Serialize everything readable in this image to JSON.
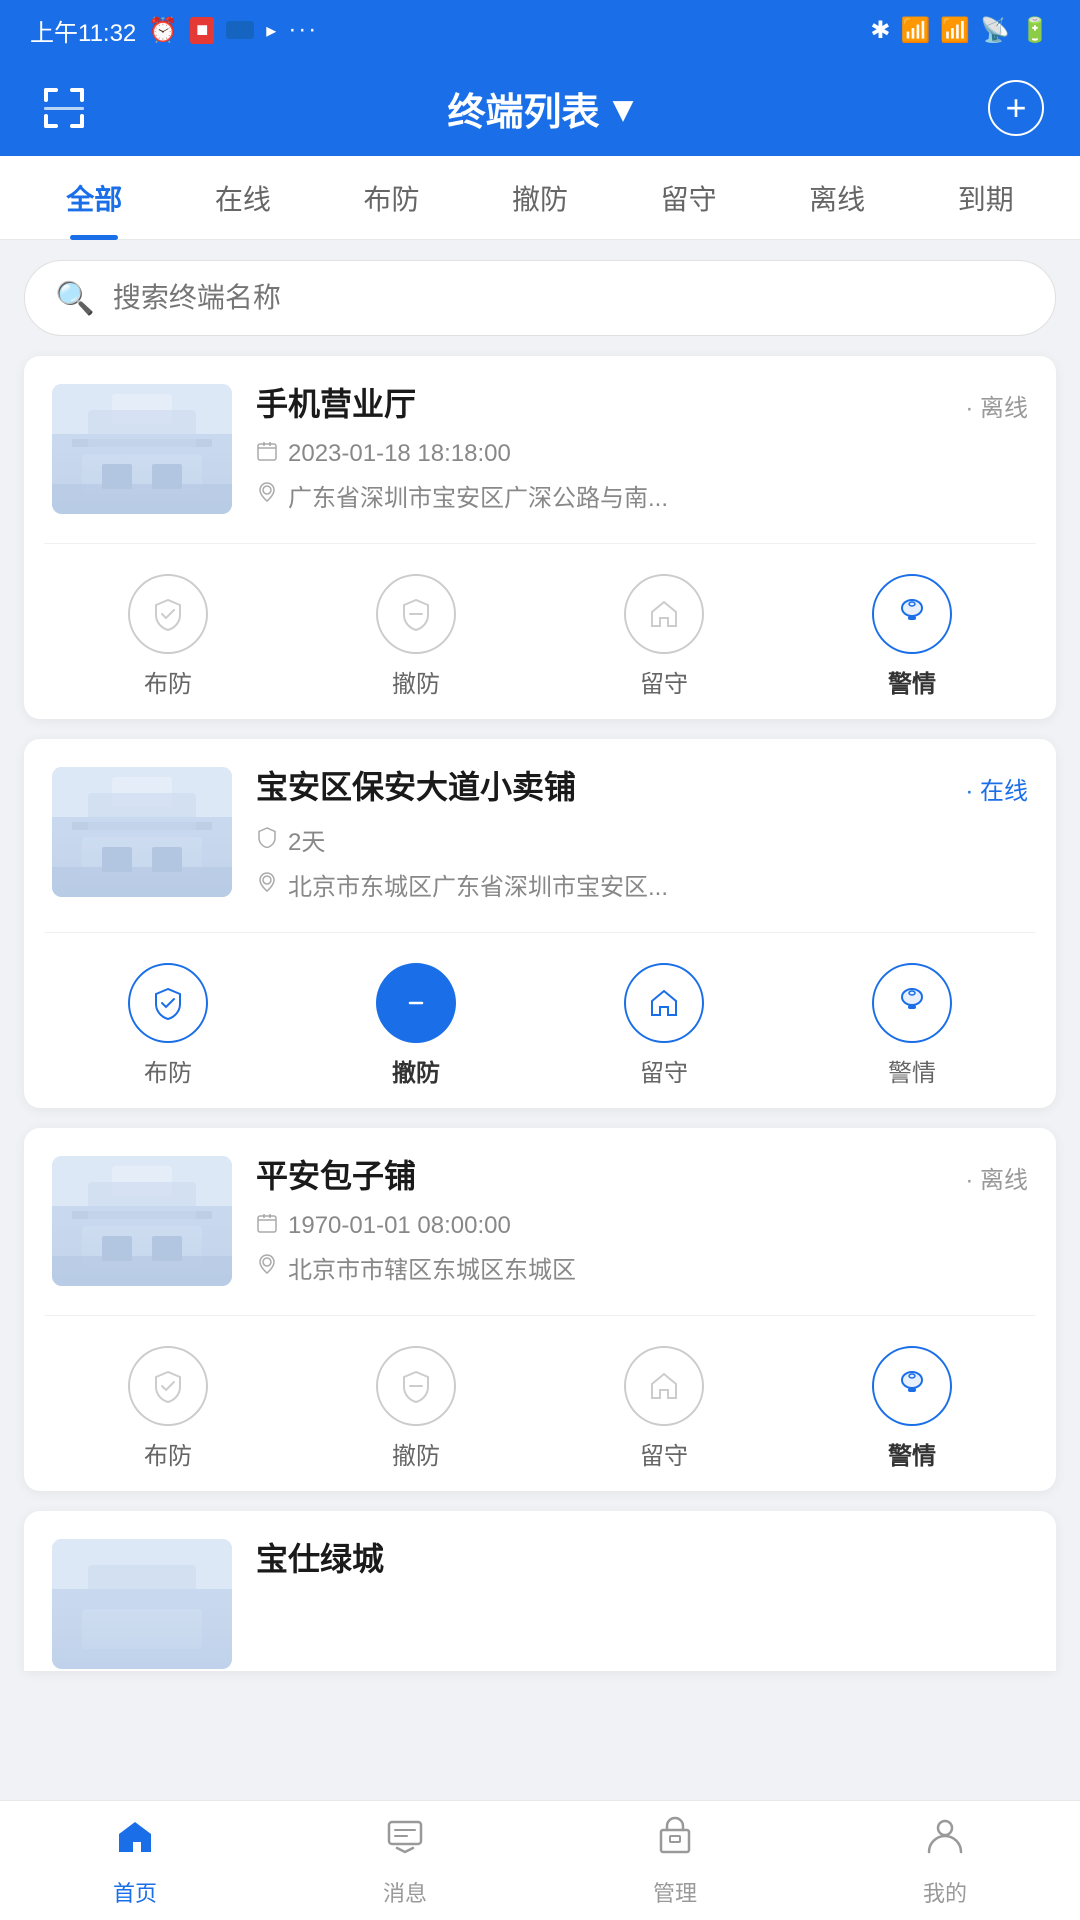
{
  "statusBar": {
    "time": "上午11:32",
    "icons": [
      "clock",
      "sim1",
      "sim2",
      "wifi",
      "battery"
    ]
  },
  "header": {
    "title": "终端列表",
    "dropdownArrow": "▾",
    "scanLabel": "scan",
    "addLabel": "add"
  },
  "tabs": [
    {
      "id": "all",
      "label": "全部",
      "active": true
    },
    {
      "id": "online",
      "label": "在线",
      "active": false
    },
    {
      "id": "armed",
      "label": "布防",
      "active": false
    },
    {
      "id": "disarmed",
      "label": "撤防",
      "active": false
    },
    {
      "id": "stay",
      "label": "留守",
      "active": false
    },
    {
      "id": "offline",
      "label": "离线",
      "active": false
    },
    {
      "id": "expired",
      "label": "到期",
      "active": false
    }
  ],
  "search": {
    "placeholder": "搜索终端名称"
  },
  "cards": [
    {
      "id": "card1",
      "name": "手机营业厅",
      "status": "· 离线",
      "statusType": "offline",
      "datetime": "2023-01-18 18:18:00",
      "address": "广东省深圳市宝安区广深公路与南...",
      "actions": [
        {
          "id": "arm",
          "label": "布防",
          "iconType": "shield-check",
          "state": "normal"
        },
        {
          "id": "disarm",
          "label": "撤防",
          "iconType": "shield-minus",
          "state": "normal"
        },
        {
          "id": "stay",
          "label": "留守",
          "iconType": "home",
          "state": "normal"
        },
        {
          "id": "alarm",
          "label": "警情",
          "iconType": "bell",
          "state": "active-blue"
        }
      ]
    },
    {
      "id": "card2",
      "name": "宝安区保安大道小卖铺",
      "status": "· 在线",
      "statusType": "online",
      "datetime": "2天",
      "address": "北京市东城区广东省深圳市宝安区...",
      "actions": [
        {
          "id": "arm",
          "label": "布防",
          "iconType": "shield-check",
          "state": "active-blue"
        },
        {
          "id": "disarm",
          "label": "撤防",
          "iconType": "shield-minus",
          "state": "filled-blue"
        },
        {
          "id": "stay",
          "label": "留守",
          "iconType": "home",
          "state": "active-blue"
        },
        {
          "id": "alarm",
          "label": "警情",
          "iconType": "bell",
          "state": "active-blue"
        }
      ]
    },
    {
      "id": "card3",
      "name": "平安包子铺",
      "status": "· 离线",
      "statusType": "offline",
      "datetime": "1970-01-01 08:00:00",
      "address": "北京市市辖区东城区东城区",
      "actions": [
        {
          "id": "arm",
          "label": "布防",
          "iconType": "shield-check",
          "state": "normal"
        },
        {
          "id": "disarm",
          "label": "撤防",
          "iconType": "shield-minus",
          "state": "normal"
        },
        {
          "id": "stay",
          "label": "留守",
          "iconType": "home",
          "state": "normal"
        },
        {
          "id": "alarm",
          "label": "警情",
          "iconType": "bell",
          "state": "active-blue"
        }
      ]
    }
  ],
  "partialCard": {
    "name": "宝仕绿城",
    "nameVisible": "宝仕绿城"
  },
  "bottomNav": [
    {
      "id": "home",
      "label": "首页",
      "active": true,
      "icon": "home"
    },
    {
      "id": "messages",
      "label": "消息",
      "active": false,
      "icon": "message"
    },
    {
      "id": "manage",
      "label": "管理",
      "active": false,
      "icon": "box"
    },
    {
      "id": "mine",
      "label": "我的",
      "active": false,
      "icon": "person"
    }
  ]
}
